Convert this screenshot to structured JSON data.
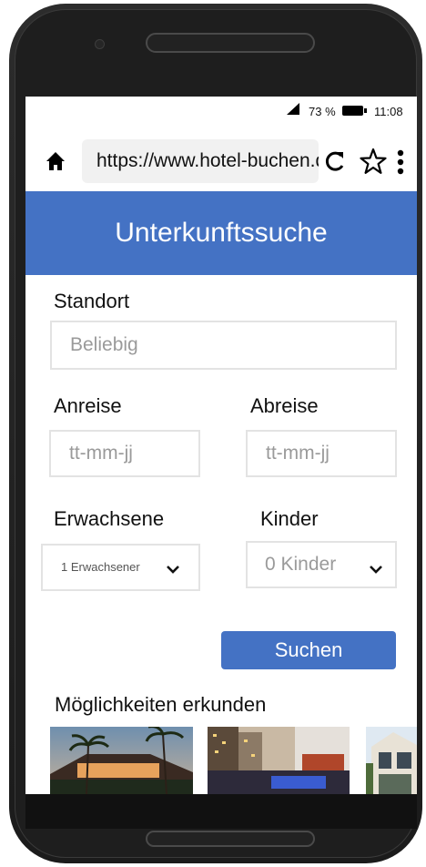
{
  "status": {
    "battery_pct": "73 %",
    "time": "11:08"
  },
  "browser": {
    "url": "https://www.hotel-buchen.de"
  },
  "page": {
    "title": "Unterkunftssuche",
    "location": {
      "label": "Standort",
      "placeholder": "Beliebig"
    },
    "arrival": {
      "label": "Anreise",
      "placeholder": "tt-mm-jj"
    },
    "departure": {
      "label": "Abreise",
      "placeholder": "tt-mm-jj"
    },
    "adults": {
      "label": "Erwachsene",
      "value": "1 Erwachsener"
    },
    "children": {
      "label": "Kinder",
      "value": "0 Kinder"
    },
    "search_button": "Suchen",
    "explore_heading": "Möglichkeiten erkunden"
  },
  "colors": {
    "accent": "#4472c4"
  }
}
